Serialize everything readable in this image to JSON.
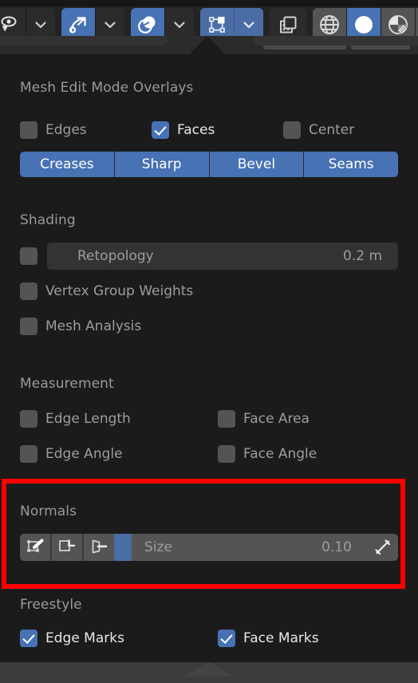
{
  "app": {
    "name": "Blender 3D Viewport Overlays Popover"
  },
  "header": {
    "groups": [
      {
        "name": "visibility-group",
        "buttons": [
          {
            "icon": "eye-selectability-icon",
            "label": "",
            "active": false
          },
          {
            "icon": "chevron-down-icon",
            "label": "",
            "active": false
          }
        ]
      },
      {
        "name": "snapping-group",
        "buttons": [
          {
            "icon": "magnet-snap-icon",
            "label": "",
            "active": true
          },
          {
            "icon": "chevron-down-icon",
            "label": "",
            "active": false
          }
        ]
      },
      {
        "name": "xray-group",
        "buttons": [
          {
            "icon": "xray-toggle-icon",
            "label": "",
            "active": true
          },
          {
            "icon": "chevron-down-icon",
            "label": "",
            "active": false
          }
        ]
      },
      {
        "name": "overlays-group",
        "buttons": [
          {
            "icon": "overlays-icon",
            "label": "",
            "active": true
          },
          {
            "icon": "chevron-down-icon",
            "label": "",
            "active": true
          }
        ]
      },
      {
        "name": "proportional-edit-group",
        "buttons": [
          {
            "icon": "proportional-editing-icon",
            "label": "",
            "active": false
          }
        ]
      },
      {
        "name": "shading-modes-group",
        "buttons": [
          {
            "icon": "shading-wireframe-icon",
            "label": "",
            "active": false
          },
          {
            "icon": "shading-solid-icon",
            "label": "",
            "active": true
          },
          {
            "icon": "shading-material-preview-icon",
            "label": "",
            "active": false
          },
          {
            "icon": "shading-rendered-icon",
            "label": "",
            "active": false
          }
        ]
      }
    ]
  },
  "popover": {
    "sections": [
      {
        "id": "mesh_edit_mode_overlays",
        "title": "Mesh Edit Mode Overlays",
        "checkboxes": [
          {
            "label": "Edges",
            "checked": false,
            "bright": false
          },
          {
            "label": "Faces",
            "checked": true,
            "bright": true
          },
          {
            "label": "Center",
            "checked": false,
            "bright": false
          }
        ],
        "pills": [
          {
            "label": "Creases",
            "active": true
          },
          {
            "label": "Sharp",
            "active": true
          },
          {
            "label": "Bevel",
            "active": true
          },
          {
            "label": "Seams",
            "active": true
          }
        ]
      },
      {
        "id": "shading",
        "title": "Shading",
        "retopology": {
          "checkbox_label": "",
          "checked": false,
          "slider_label": "Retopology",
          "slider_value": "0.2 m",
          "fill_percent": 0
        },
        "checkboxes": [
          {
            "label": "Vertex Group Weights",
            "checked": false
          },
          {
            "label": "Mesh Analysis",
            "checked": false
          }
        ]
      },
      {
        "id": "measurement",
        "title": "Measurement",
        "checkboxes_left": [
          {
            "label": "Edge Length",
            "checked": false
          },
          {
            "label": "Edge Angle",
            "checked": false
          }
        ],
        "checkboxes_right": [
          {
            "label": "Face Area",
            "checked": false
          },
          {
            "label": "Face Angle",
            "checked": false
          }
        ]
      },
      {
        "id": "normals",
        "title": "Normals",
        "highlighted": true,
        "highlight_color": "#ff0000",
        "toggles": [
          {
            "icon": "vertex-normals-icon",
            "active": false
          },
          {
            "icon": "split-normals-icon",
            "active": false
          },
          {
            "icon": "face-normals-icon",
            "active": false
          }
        ],
        "size_slider": {
          "label": "Size",
          "value": "0.10",
          "fill_percent": 7
        },
        "trailing_button": {
          "icon": "normal-screen-size-icon",
          "active": false
        }
      },
      {
        "id": "freestyle",
        "title": "Freestyle",
        "checkboxes_left": [
          {
            "label": "Edge Marks",
            "checked": true
          }
        ],
        "checkboxes_right": [
          {
            "label": "Face Marks",
            "checked": true
          }
        ]
      }
    ]
  },
  "colors": {
    "accent_blue": "#4772b3",
    "panel_bg": "#1b1b1b",
    "header_bg": "#2b2b2b",
    "widget_grey": "#545454",
    "text_dim": "#9d9d9d",
    "text_bright": "#e8e8e8",
    "highlight_red": "#ff0000"
  }
}
